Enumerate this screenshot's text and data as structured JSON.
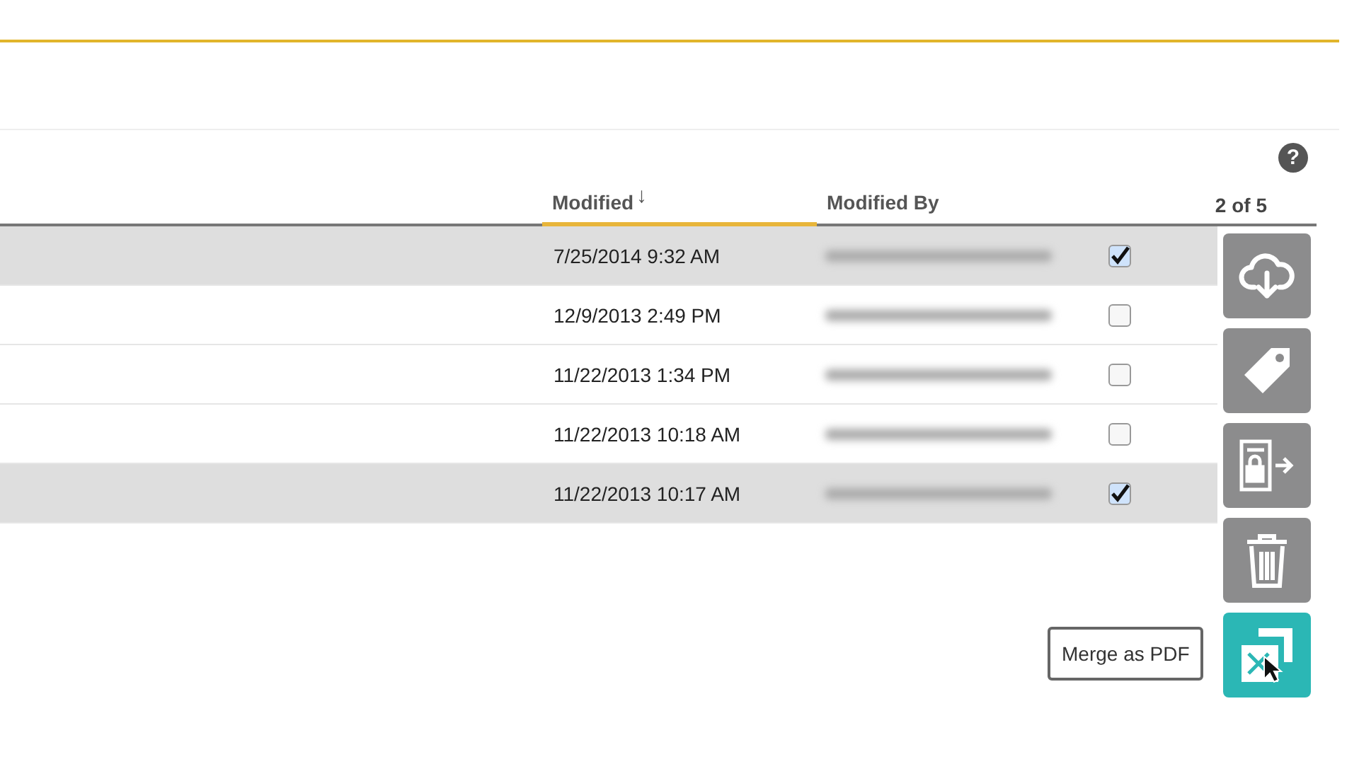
{
  "help": "?",
  "table": {
    "columns": [
      {
        "label": "Modified",
        "sorted": true,
        "sort_arrow": "↓"
      },
      {
        "label": "Modified By",
        "sorted": false
      }
    ],
    "counter": "2 of 5",
    "rows": [
      {
        "modified": "7/25/2014 9:32 AM",
        "selected": true,
        "checked": true
      },
      {
        "modified": "12/9/2013 2:49 PM",
        "selected": false,
        "checked": false
      },
      {
        "modified": "11/22/2013 1:34 PM",
        "selected": false,
        "checked": false
      },
      {
        "modified": "11/22/2013 10:18 AM",
        "selected": false,
        "checked": false
      },
      {
        "modified": "11/22/2013 10:17 AM",
        "selected": true,
        "checked": true
      }
    ]
  },
  "actions": [
    {
      "kind": "download",
      "selected": false
    },
    {
      "kind": "tag",
      "selected": false
    },
    {
      "kind": "checkout",
      "selected": false
    },
    {
      "kind": "delete",
      "selected": false
    },
    {
      "kind": "merge",
      "selected": true
    }
  ],
  "tooltip": "Merge as PDF"
}
